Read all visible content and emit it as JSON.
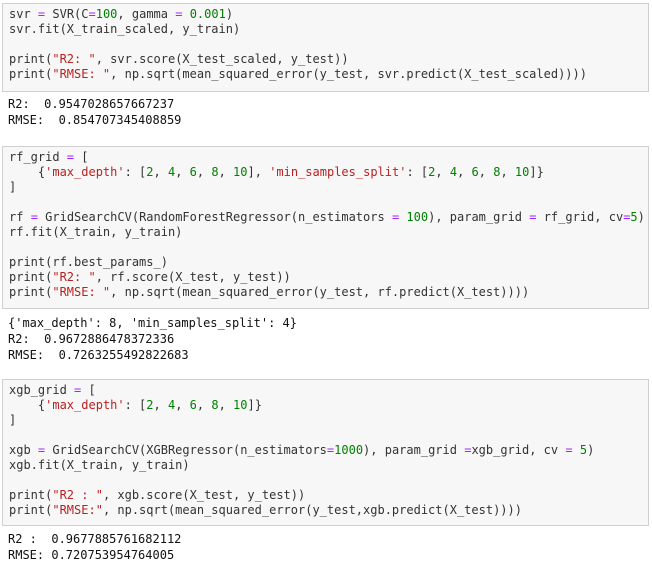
{
  "cells": [
    {
      "code": [
        [
          [
            "svr ",
            "fn"
          ],
          [
            "=",
            "op"
          ],
          [
            " SVR(C",
            "fn"
          ],
          [
            "=",
            "op"
          ],
          [
            "100",
            "num"
          ],
          [
            ", gamma ",
            "fn"
          ],
          [
            "=",
            "op"
          ],
          [
            " ",
            "fn"
          ],
          [
            "0.001",
            "num"
          ],
          [
            ")",
            "fn"
          ]
        ],
        [
          [
            "svr.fit(X_train_scaled, y_train)",
            "fn"
          ]
        ],
        [],
        [
          [
            "print(",
            "fn"
          ],
          [
            "\"R2: \"",
            "str"
          ],
          [
            ", svr.score(X_test_scaled, y_test))",
            "fn"
          ]
        ],
        [
          [
            "print(",
            "fn"
          ],
          [
            "\"RMSE: \"",
            "str"
          ],
          [
            ", np.sqrt(mean_squared_error(y_test, svr.predict(X_test_scaled))))",
            "fn"
          ]
        ]
      ],
      "output": [
        "R2:  0.9547028657667237",
        "RMSE:  0.854707345408859"
      ]
    },
    {
      "code": [
        [
          [
            "rf_grid ",
            "fn"
          ],
          [
            "=",
            "op"
          ],
          [
            " [",
            "fn"
          ]
        ],
        [
          [
            "    {",
            "fn"
          ],
          [
            "'max_depth'",
            "str"
          ],
          [
            ": [",
            "fn"
          ],
          [
            "2",
            "num"
          ],
          [
            ", ",
            "fn"
          ],
          [
            "4",
            "num"
          ],
          [
            ", ",
            "fn"
          ],
          [
            "6",
            "num"
          ],
          [
            ", ",
            "fn"
          ],
          [
            "8",
            "num"
          ],
          [
            ", ",
            "fn"
          ],
          [
            "10",
            "num"
          ],
          [
            "], ",
            "fn"
          ],
          [
            "'min_samples_split'",
            "str"
          ],
          [
            ": [",
            "fn"
          ],
          [
            "2",
            "num"
          ],
          [
            ", ",
            "fn"
          ],
          [
            "4",
            "num"
          ],
          [
            ", ",
            "fn"
          ],
          [
            "6",
            "num"
          ],
          [
            ", ",
            "fn"
          ],
          [
            "8",
            "num"
          ],
          [
            ", ",
            "fn"
          ],
          [
            "10",
            "num"
          ],
          [
            "]}",
            "fn"
          ]
        ],
        [
          [
            "]",
            "fn"
          ]
        ],
        [],
        [
          [
            "rf ",
            "fn"
          ],
          [
            "=",
            "op"
          ],
          [
            " GridSearchCV(RandomForestRegressor(n_estimators ",
            "fn"
          ],
          [
            "=",
            "op"
          ],
          [
            " ",
            "fn"
          ],
          [
            "100",
            "num"
          ],
          [
            "), param_grid ",
            "fn"
          ],
          [
            "=",
            "op"
          ],
          [
            " rf_grid, cv",
            "fn"
          ],
          [
            "=",
            "op"
          ],
          [
            "5",
            "num"
          ],
          [
            ")",
            "fn"
          ]
        ],
        [
          [
            "rf.fit(X_train, y_train)",
            "fn"
          ]
        ],
        [],
        [
          [
            "print(rf.best_params_)",
            "fn"
          ]
        ],
        [
          [
            "print(",
            "fn"
          ],
          [
            "\"R2: \"",
            "str"
          ],
          [
            ", rf.score(X_test, y_test))",
            "fn"
          ]
        ],
        [
          [
            "print(",
            "fn"
          ],
          [
            "\"RMSE: \"",
            "str"
          ],
          [
            ", np.sqrt(mean_squared_error(y_test, rf.predict(X_test))))",
            "fn"
          ]
        ]
      ],
      "output": [
        "{'max_depth': 8, 'min_samples_split': 4}",
        "R2:  0.9672886478372336",
        "RMSE:  0.7263255492822683"
      ]
    },
    {
      "code": [
        [
          [
            "xgb_grid ",
            "fn"
          ],
          [
            "=",
            "op"
          ],
          [
            " [",
            "fn"
          ]
        ],
        [
          [
            "    {",
            "fn"
          ],
          [
            "'max_depth'",
            "str"
          ],
          [
            ": [",
            "fn"
          ],
          [
            "2",
            "num"
          ],
          [
            ", ",
            "fn"
          ],
          [
            "4",
            "num"
          ],
          [
            ", ",
            "fn"
          ],
          [
            "6",
            "num"
          ],
          [
            ", ",
            "fn"
          ],
          [
            "8",
            "num"
          ],
          [
            ", ",
            "fn"
          ],
          [
            "10",
            "num"
          ],
          [
            "]}",
            "fn"
          ]
        ],
        [
          [
            "]",
            "fn"
          ]
        ],
        [],
        [
          [
            "xgb ",
            "fn"
          ],
          [
            "=",
            "op"
          ],
          [
            " GridSearchCV(XGBRegressor(n_estimators",
            "fn"
          ],
          [
            "=",
            "op"
          ],
          [
            "1000",
            "num"
          ],
          [
            "), param_grid ",
            "fn"
          ],
          [
            "=",
            "op"
          ],
          [
            "xgb_grid, cv ",
            "fn"
          ],
          [
            "=",
            "op"
          ],
          [
            " ",
            "fn"
          ],
          [
            "5",
            "num"
          ],
          [
            ")",
            "fn"
          ]
        ],
        [
          [
            "xgb.fit(X_train, y_train)",
            "fn"
          ]
        ],
        [],
        [
          [
            "print(",
            "fn"
          ],
          [
            "\"R2 : \"",
            "str"
          ],
          [
            ", xgb.score(X_test, y_test))",
            "fn"
          ]
        ],
        [
          [
            "print(",
            "fn"
          ],
          [
            "\"RMSE:\"",
            "str"
          ],
          [
            ", np.sqrt(mean_squared_error(y_test,xgb.predict(X_test))))",
            "fn"
          ]
        ]
      ],
      "output": [
        "R2 :  0.9677885761682112",
        "RMSE: 0.720753954764005"
      ]
    }
  ]
}
